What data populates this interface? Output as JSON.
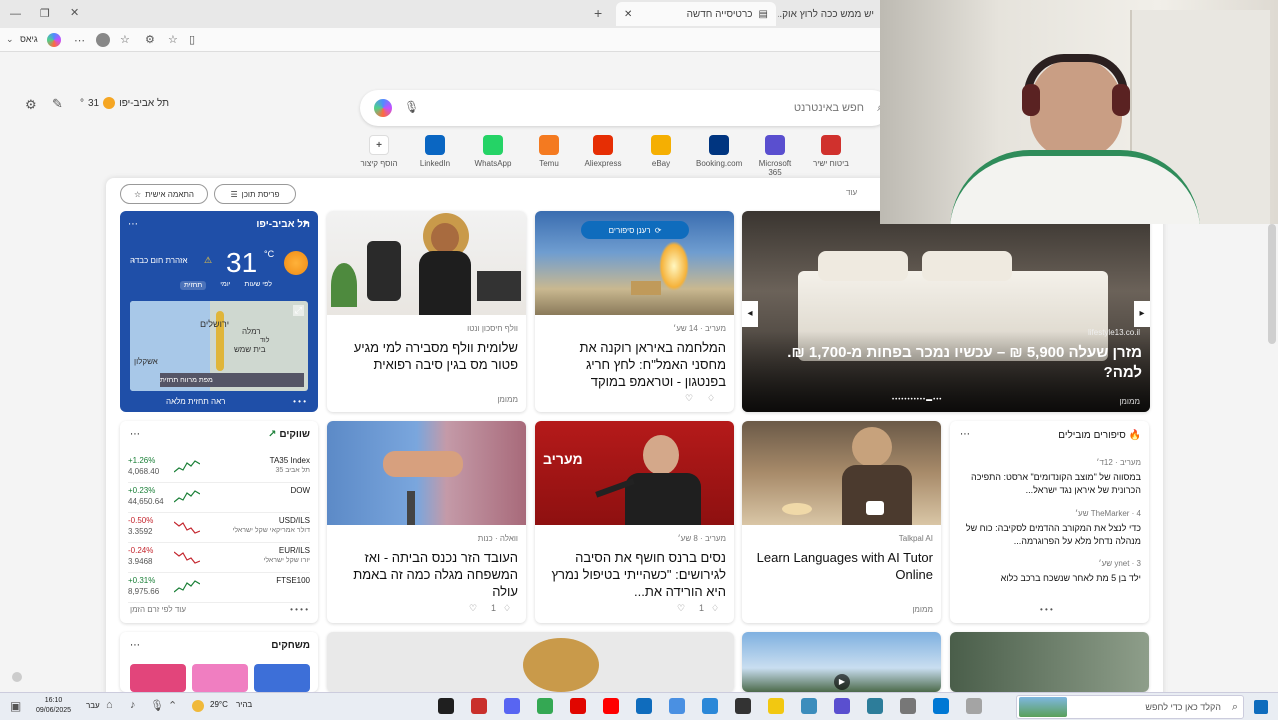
{
  "tabs": [
    {
      "label": "כרטיסייה חדשה"
    },
    {
      "label": "יש ממש ככה לרוץ אוק..."
    }
  ],
  "toolbar": {
    "profile_label": "גיאס"
  },
  "topbar": {
    "location": "תל אביב-יפו",
    "temp": "31",
    "unit": "°"
  },
  "search": {
    "placeholder": "חפש באינטרנט"
  },
  "quicklinks": [
    {
      "label": "הוסף קיצור",
      "icon": "plus-icon",
      "color": "#ffffff"
    },
    {
      "label": "LinkedIn",
      "icon": "linkedin-icon",
      "color": "#0a66c2"
    },
    {
      "label": "WhatsApp",
      "icon": "whatsapp-icon",
      "color": "#25d366"
    },
    {
      "label": "Temu",
      "icon": "temu-icon",
      "color": "#f47a20"
    },
    {
      "label": "Aliexpress",
      "icon": "aliexpress-icon",
      "color": "#e62e04"
    },
    {
      "label": "eBay",
      "icon": "ebay-icon",
      "color": "#f5af02"
    },
    {
      "label": "Booking.com",
      "icon": "booking-icon",
      "color": "#003580"
    },
    {
      "label": "Microsoft 365",
      "icon": "m365-icon",
      "color": "#5a4fcf"
    },
    {
      "label": "ביטוח ישיר",
      "icon": "insurance-icon",
      "color": "#d0312d"
    }
  ],
  "feed": {
    "personalize": "התאמה אישית",
    "layout": "פריסת תוכן",
    "more": "עוד"
  },
  "weather": {
    "city": "תל אביב-יפו",
    "temp": "31",
    "unit": "°C",
    "alert": "אזהרת חום כבדה",
    "tabs": [
      "לפי שעות",
      "יומי",
      "תחזית"
    ],
    "map_labels": [
      "ירושלים",
      "רמלה",
      "בית שמש",
      "אשקלון",
      "לוד"
    ],
    "map_link": "מפת מרווח תחזית",
    "footer": "ראה תחזית מלאה"
  },
  "cards": {
    "hero": {
      "title": "מזרן שעלה 5,900 ₪ – עכשיו נמכר בפחות מ-1,700 ₪. למה?",
      "source": "lifestyle13.co.il",
      "footer": "ממומן"
    },
    "missile": {
      "source": "מעריב · 14 שע׳",
      "title": "המלחמה באיראן רוקנה את מחסני האמל\"ח: לחץ חריג בפנטגון - וטראמפ במוקד",
      "badge": "רענן סיפורים"
    },
    "woman": {
      "source": "וולף חיסכון ונטו",
      "title": "שלומית וולף מסבירה למי מגיע פטור מס בגין סיבה רפואית",
      "footer": "ממומן"
    },
    "nursing": {
      "source": "וואלה · כנות",
      "title": "העובד הזר נכנס הביתה - ואז המשפחה מגלה כמה זה באמת עולה",
      "likes": "1"
    },
    "maariv": {
      "source": "מעריב · 8 שע׳",
      "title": "נסים ברנס חושף את הסיבה לגירושים: \"כשהייתי בטיפול נמרץ היא הורידה את...",
      "likes": "1",
      "brand": "מעריב"
    },
    "tutor": {
      "source": "Talkpal AI",
      "title": "Learn Languages with AI Tutor Online",
      "footer": "ממומן"
    }
  },
  "stories": {
    "header": "סיפורים מובילים",
    "items": [
      {
        "source": "מעריב · 12ד׳",
        "text": "במסווה של \"מוצב הקונדומים\" ארסט: התפיכה הכרונית של איראן נגד ישראל..."
      },
      {
        "source": "TheMarker · 4 שע׳",
        "text": "כדי לנצל את המקורב ההדמים לסקיבה: כוח של מנהלה נדחל מלא על הפרוגרמה..."
      },
      {
        "source": "ynet · 3 שע׳",
        "text": "ילד בן 5 מת לאחר שנשכח ברכב כלוא"
      }
    ]
  },
  "stocks": {
    "header": "שווקים",
    "items": [
      {
        "name": "TA35 Index",
        "sub": "תל אביב 35",
        "change": "+1.26%",
        "value": "4,068.40",
        "color": "#1a7f37"
      },
      {
        "name": "DOW",
        "sub": "",
        "change": "+0.23%",
        "value": "44,650.64",
        "color": "#1a7f37"
      },
      {
        "name": "USD/ILS",
        "sub": "דולר אמריקאי שקל ישראלי",
        "change": "-0.50%",
        "value": "3.3592",
        "color": "#c4262e"
      },
      {
        "name": "EUR/ILS",
        "sub": "יורו שקל ישראלי",
        "change": "-0.24%",
        "value": "3.9468",
        "color": "#c4262e"
      },
      {
        "name": "FTSE100",
        "sub": "",
        "change": "+0.31%",
        "value": "8,975.66",
        "color": "#1a7f37"
      }
    ],
    "footer": "עוד לפי זרם הזמן"
  },
  "games": {
    "header": "משחקים"
  },
  "taskbar": {
    "time": "16:10",
    "date": "09/06/2025",
    "temp": "29°C",
    "weather": "בהיר",
    "search": "הקלד כאן כדי לחפש",
    "lang": "עבר"
  },
  "colors": {
    "accent": "#0f6cbd",
    "weather_bg": "#1f4fa8"
  }
}
